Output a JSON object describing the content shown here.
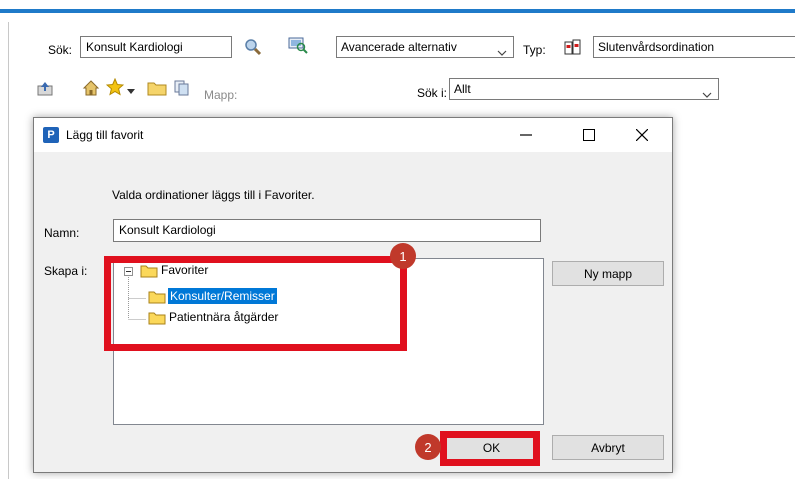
{
  "search": {
    "label": "Sök:",
    "value": "Konsult Kardiologi"
  },
  "advanced": {
    "value": "Avancerade alternativ"
  },
  "type": {
    "label": "Typ:",
    "value": "Slutenvårdsordination"
  },
  "folder_label": "Mapp:",
  "search_in": {
    "label": "Sök i:",
    "value": "Allt"
  },
  "dialog": {
    "title": "Lägg till favorit",
    "app_icon_letter": "P",
    "info_text": "Valda ordinationer läggs till i Favoriter.",
    "name_label": "Namn:",
    "name_value": "Konsult Kardiologi",
    "create_in_label": "Skapa i:",
    "tree": {
      "root": "Favoriter",
      "children": [
        "Konsulter/Remisser",
        "Patientnära åtgärder"
      ],
      "selected": "Konsulter/Remisser"
    },
    "new_folder_button": "Ny mapp",
    "ok_button": "OK",
    "cancel_button": "Avbryt"
  },
  "annotations": {
    "badge_1": "1",
    "badge_2": "2",
    "highlight_color": "#e0101e"
  },
  "colors": {
    "selection": "#0078d7",
    "accent": "#1f7ac9"
  }
}
